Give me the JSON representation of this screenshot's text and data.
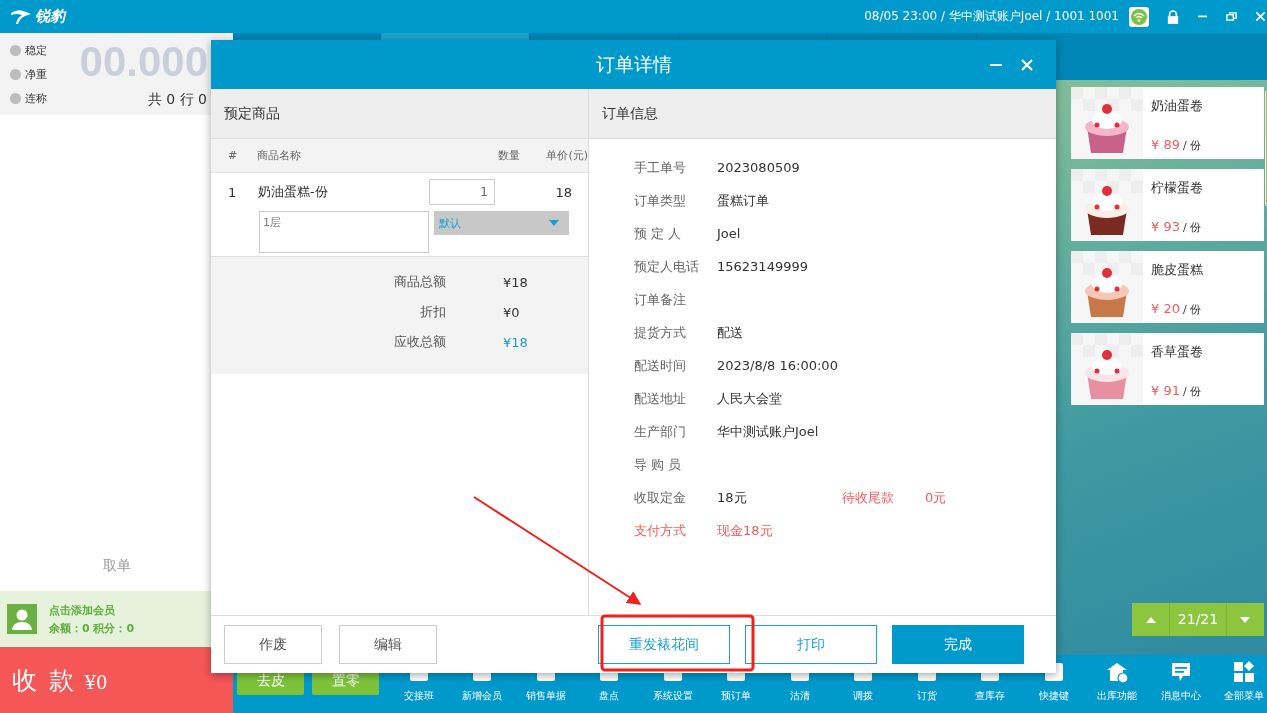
{
  "app": {
    "logo": "锐豹",
    "status": "08/05 23:00 / 华中测试账户Joel / 1001 1001"
  },
  "scale": {
    "indicators": [
      "稳定",
      "净重",
      "连称"
    ],
    "reading": "00.000",
    "summary": "共 0 行 0"
  },
  "pickup": "取单",
  "member": {
    "title": "点击添加会员",
    "balance": "余额：0  积分：0"
  },
  "pay": {
    "label": "收 款",
    "amount": "¥0"
  },
  "products": [
    {
      "name": "奶油蛋卷",
      "price": "¥ 89",
      "unit": "/ 份"
    },
    {
      "name": "柠檬蛋卷",
      "price": "¥ 93",
      "unit": "/ 份"
    },
    {
      "name": "脆皮蛋糕",
      "price": "¥ 20",
      "unit": "/ 份"
    },
    {
      "name": "香草蛋卷",
      "price": "¥ 91",
      "unit": "/ 份"
    }
  ],
  "pager": {
    "page": "21/21"
  },
  "toolbar": {
    "buttons": [
      "去皮",
      "置零"
    ],
    "items": [
      "交接班",
      "新增会员",
      "销售单据",
      "盘点",
      "系统设置",
      "预订单",
      "沽清",
      "调拨",
      "订货",
      "查库存",
      "快捷键",
      "出库功能",
      "消息中心",
      "全部菜单"
    ]
  },
  "dialog": {
    "title": "订单详情",
    "left": {
      "heading": "预定商品",
      "columns": [
        "#",
        "商品名称",
        "数量",
        "单价(元)"
      ],
      "rows": [
        {
          "index": "1",
          "name": "奶油蛋糕-份",
          "qty": "1",
          "price": "18",
          "note": "1层",
          "option": "默认"
        }
      ],
      "totals": [
        {
          "label": "商品总额",
          "value": "¥18",
          "highlight": false
        },
        {
          "label": "折扣",
          "value": "¥0",
          "highlight": false
        },
        {
          "label": "应收总额",
          "value": "¥18",
          "highlight": true
        }
      ]
    },
    "right": {
      "heading": "订单信息",
      "fields": [
        {
          "label": "手工单号",
          "value": "2023080509",
          "alert": false
        },
        {
          "label": "订单类型",
          "value": "蛋糕订单",
          "alert": false
        },
        {
          "label": "预 定 人",
          "value": "Joel",
          "alert": false
        },
        {
          "label": "预定人电话",
          "value": "15623149999",
          "alert": false
        },
        {
          "label": "订单备注",
          "alert": false
        },
        {
          "label": "提货方式",
          "value": "配送",
          "alert": false
        },
        {
          "label": "配送时间",
          "value": "2023/8/8 16:00:00",
          "alert": false
        },
        {
          "label": "配送地址",
          "value": "人民大会堂",
          "alert": false
        },
        {
          "label": "生产部门",
          "value": "华中测试账户Joel",
          "alert": false
        },
        {
          "label": "导 购 员",
          "alert": false
        },
        {
          "label": "收取定金",
          "value": "18元",
          "alert": false,
          "extra_label": "待收尾款",
          "extra_value": "0元"
        },
        {
          "label": "支付方式",
          "value": "现金18元",
          "alert": true
        }
      ]
    },
    "buttons": [
      {
        "label": "作废",
        "kind": "plain"
      },
      {
        "label": "编辑",
        "kind": "plain"
      },
      {
        "label": "重发裱花间",
        "kind": "outline"
      },
      {
        "label": "打印",
        "kind": "outline"
      },
      {
        "label": "完成",
        "kind": "primary"
      }
    ]
  }
}
